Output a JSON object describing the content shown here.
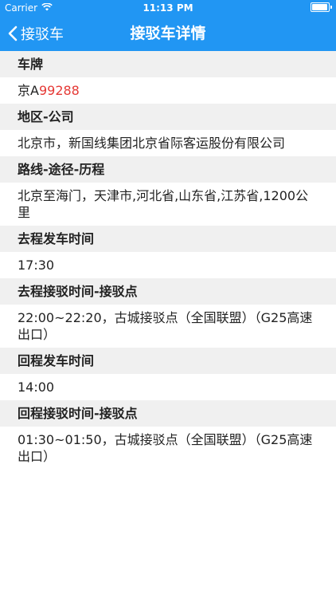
{
  "status_bar": {
    "carrier": "Carrier",
    "time": "11:13 PM"
  },
  "nav": {
    "back_label": "接驳车",
    "title": "接驳车详情"
  },
  "sections": {
    "plate": {
      "header": "车牌",
      "prefix": "京A",
      "number": "99288"
    },
    "region": {
      "header": "地区-公司",
      "value": "北京市，新国线集团北京省际客运股份有限公司"
    },
    "route": {
      "header": "路线-途径-历程",
      "value": "北京至海门，天津市,河北省,山东省,江苏省,1200公里"
    },
    "out_depart": {
      "header": "去程发车时间",
      "value": "17:30"
    },
    "out_transfer": {
      "header": "去程接驳时间-接驳点",
      "value": "22:00~22:20，古城接驳点（全国联盟）（G25高速出口）"
    },
    "return_depart": {
      "header": "回程发车时间",
      "value": "14:00"
    },
    "return_transfer": {
      "header": "回程接驳时间-接驳点",
      "value": "01:30~01:50，古城接驳点（全国联盟）（G25高速出口）"
    }
  },
  "colors": {
    "accent": "#2196f3",
    "plate_number": "#e53935",
    "section_bg": "#f0f0f0"
  }
}
